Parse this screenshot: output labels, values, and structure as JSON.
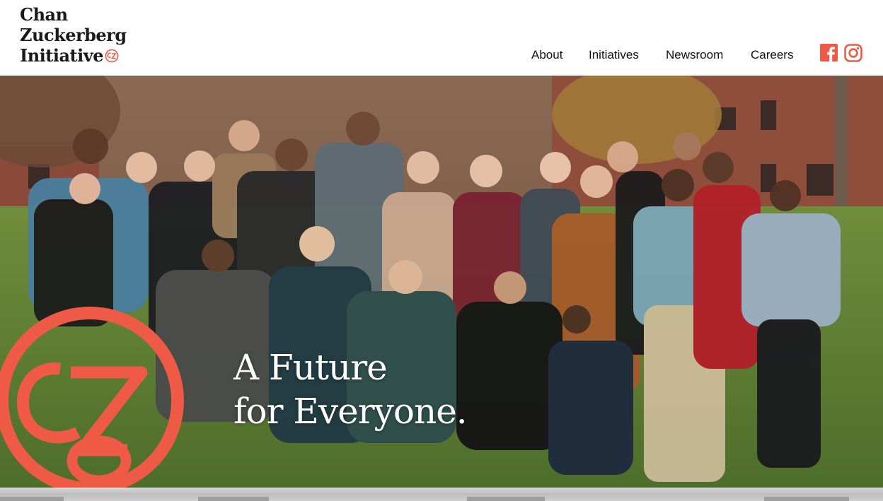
{
  "brand": {
    "line1": "Chan",
    "line2": "Zuckerberg",
    "line3": "Initiative",
    "accent_color": "#ef5a47"
  },
  "nav": {
    "items": [
      {
        "label": "About"
      },
      {
        "label": "Initiatives"
      },
      {
        "label": "Newsroom"
      },
      {
        "label": "Careers"
      }
    ]
  },
  "social": {
    "facebook_icon": "facebook-icon",
    "instagram_icon": "instagram-icon",
    "color": "#ef5a47"
  },
  "hero": {
    "title_line1": "A Future",
    "title_line2": "for Everyone.",
    "photo_icon": "group-photo"
  }
}
